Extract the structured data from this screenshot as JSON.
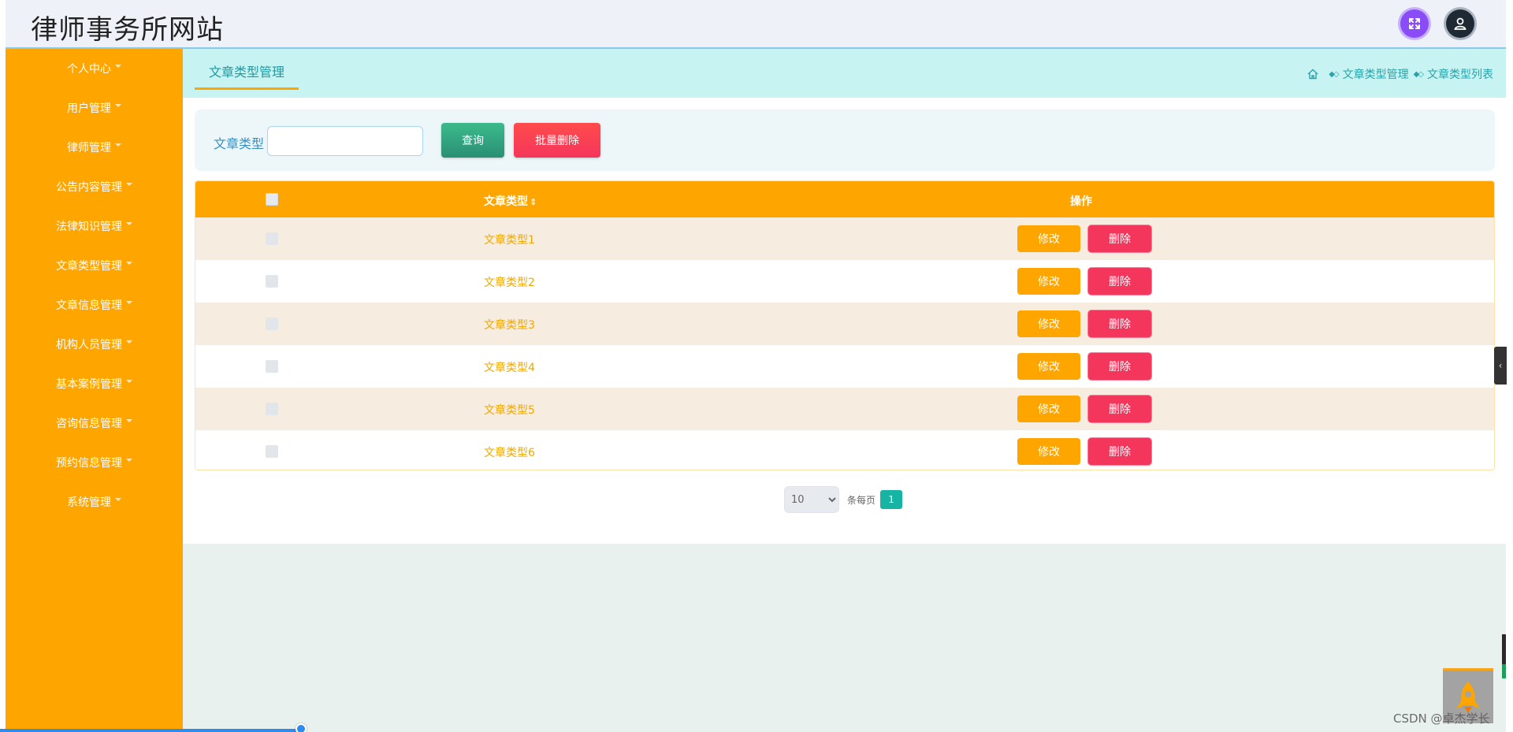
{
  "header": {
    "site_title": "律师事务所网站"
  },
  "sidebar": {
    "items": [
      {
        "label": "个人中心"
      },
      {
        "label": "用户管理"
      },
      {
        "label": "律师管理"
      },
      {
        "label": "公告内容管理"
      },
      {
        "label": "法律知识管理"
      },
      {
        "label": "文章类型管理"
      },
      {
        "label": "文章信息管理"
      },
      {
        "label": "机构人员管理"
      },
      {
        "label": "基本案例管理"
      },
      {
        "label": "咨询信息管理"
      },
      {
        "label": "预约信息管理"
      },
      {
        "label": "系统管理"
      }
    ]
  },
  "tabs": {
    "active_label": "文章类型管理"
  },
  "breadcrumb": {
    "items": [
      "文章类型管理",
      "文章类型列表"
    ]
  },
  "search": {
    "label": "文章类型",
    "value": "",
    "placeholder": "",
    "query_button": "查询",
    "batch_delete_button": "批量删除"
  },
  "table": {
    "columns": {
      "type": "文章类型",
      "operation": "操作"
    },
    "rows": [
      {
        "type": "文章类型1"
      },
      {
        "type": "文章类型2"
      },
      {
        "type": "文章类型3"
      },
      {
        "type": "文章类型4"
      },
      {
        "type": "文章类型5"
      },
      {
        "type": "文章类型6"
      }
    ],
    "edit_label": "修改",
    "delete_label": "删除"
  },
  "pagination": {
    "page_size": "10",
    "per_page_label": "条每页",
    "current_page": "1"
  },
  "watermark": "CSDN @卓杰学长",
  "colors": {
    "sidebar": "#ffa500",
    "accent": "#17b3a3",
    "danger": "#f5365c",
    "query": "#3cba8c"
  }
}
